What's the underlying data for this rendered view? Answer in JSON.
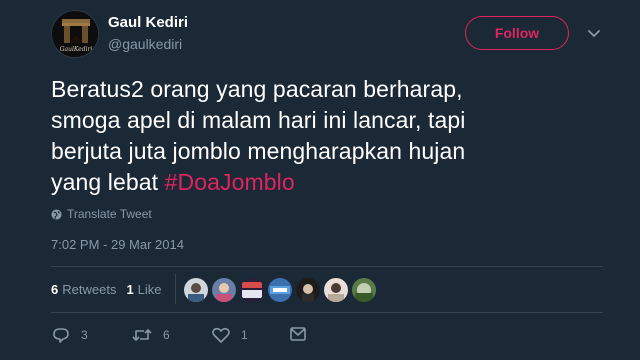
{
  "user": {
    "display_name": "Gaul Kediri",
    "handle": "@gaulkediri",
    "avatar_text": "GaulKediri"
  },
  "follow_label": "Follow",
  "tweet": {
    "lines": [
      "Beratus2 orang yang pacaran berharap,",
      "smoga apel di malam hari ini lancar, tapi",
      "berjuta juta jomblo mengharapkan hujan"
    ],
    "last_line_text": "yang lebat ",
    "hashtag": "#DoaJomblo"
  },
  "translate_label": "Translate Tweet",
  "timestamp": "7:02 PM - 29 Mar 2014",
  "stats": {
    "retweets_count": "6",
    "retweets_label": "Retweets",
    "likes_count": "1",
    "likes_label": "Like"
  },
  "actions": {
    "reply_count": "3",
    "retweet_count": "6",
    "like_count": "1"
  },
  "colors": {
    "background": "#1b2836",
    "accent": "#e0245e",
    "secondary_text": "#8899a6",
    "divider": "#38444d"
  },
  "icons": {
    "caret": "chevron-down-icon",
    "translate": "globe-icon",
    "reply": "reply-icon",
    "retweet": "retweet-icon",
    "like": "heart-icon",
    "dm": "envelope-icon"
  }
}
